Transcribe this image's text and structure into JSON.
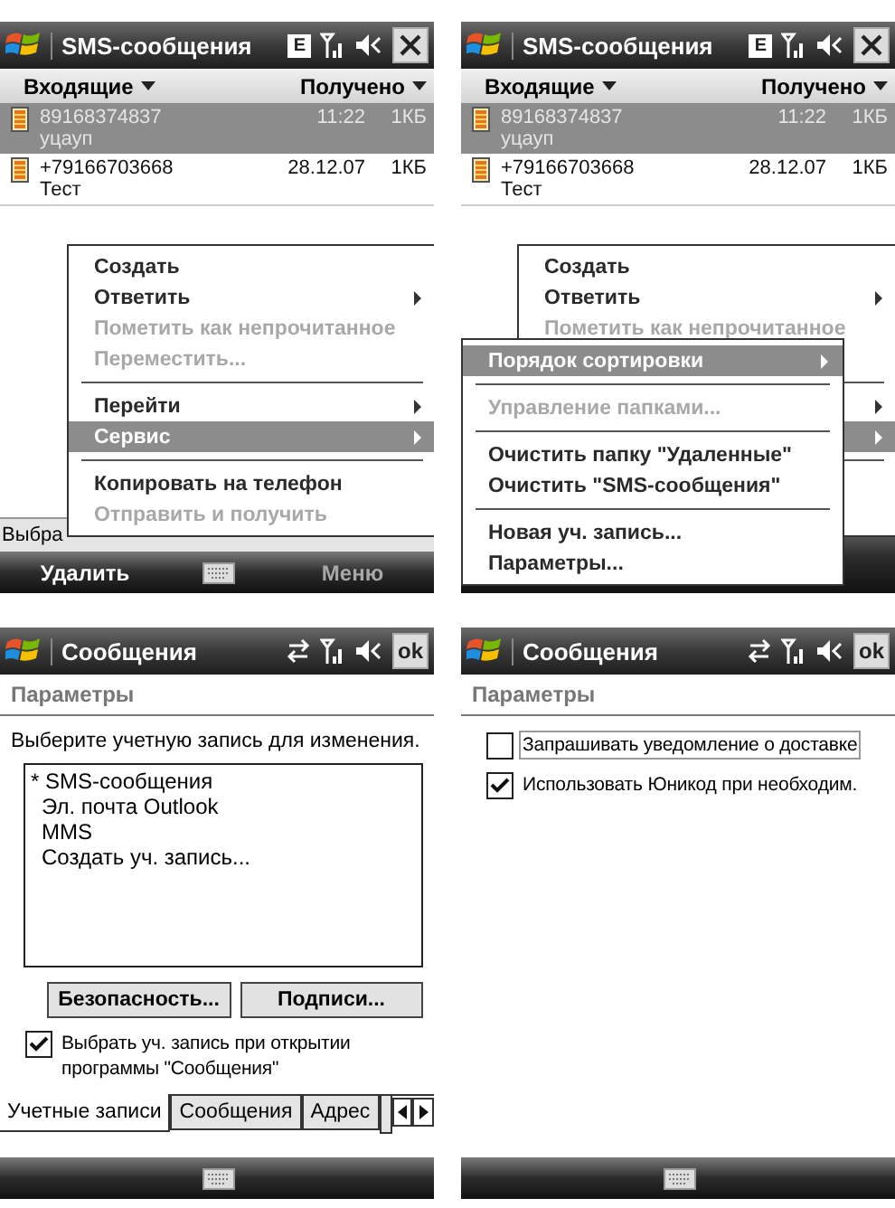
{
  "screens": [
    {
      "kind": "message_list",
      "title_bar": {
        "title": "SMS-сообщения",
        "indicators": [
          {
            "kind": "edge",
            "label": "E"
          },
          {
            "kind": "signal"
          },
          {
            "kind": "volume"
          }
        ],
        "action": {
          "kind": "close"
        }
      },
      "list_header": {
        "folder": "Входящие",
        "sort": "Получено"
      },
      "messages": [
        {
          "sender": "89168374837",
          "time": "11:22",
          "size": "1КБ",
          "preview": "уцауп",
          "selected": true
        },
        {
          "sender": "+79166703668",
          "time": "28.12.07",
          "size": "1КБ",
          "preview": "Тест",
          "selected": false
        }
      ],
      "status_text": "Выбра",
      "menu": {
        "items": [
          {
            "kind": "item",
            "label": "Создать",
            "disabled": false,
            "submenu": false,
            "selected": false
          },
          {
            "kind": "item",
            "label": "Ответить",
            "disabled": false,
            "submenu": true,
            "selected": false
          },
          {
            "kind": "item",
            "label": "Пометить как непрочитанное",
            "disabled": true,
            "submenu": false,
            "selected": false
          },
          {
            "kind": "item",
            "label": "Переместить...",
            "disabled": true,
            "submenu": false,
            "selected": false
          },
          {
            "kind": "separator"
          },
          {
            "kind": "item",
            "label": "Перейти",
            "disabled": false,
            "submenu": true,
            "selected": false
          },
          {
            "kind": "item",
            "label": "Сервис",
            "disabled": false,
            "submenu": true,
            "selected": true
          },
          {
            "kind": "separator"
          },
          {
            "kind": "item",
            "label": "Копировать на телефон",
            "disabled": false,
            "submenu": false,
            "selected": false
          },
          {
            "kind": "item",
            "label": "Отправить и получить",
            "disabled": true,
            "submenu": false,
            "selected": false
          }
        ]
      },
      "softkeys": [
        {
          "label": "Удалить",
          "dimmed": false
        },
        {
          "label": "Меню",
          "dimmed": true
        }
      ]
    },
    {
      "kind": "message_list",
      "title_bar": {
        "title": "SMS-сообщения",
        "indicators": [
          {
            "kind": "edge",
            "label": "E"
          },
          {
            "kind": "signal"
          },
          {
            "kind": "volume"
          }
        ],
        "action": {
          "kind": "close"
        }
      },
      "list_header": {
        "folder": "Входящие",
        "sort": "Получено"
      },
      "messages": [
        {
          "sender": "89168374837",
          "time": "11:22",
          "size": "1КБ",
          "preview": "уцауп",
          "selected": true
        },
        {
          "sender": "+79166703668",
          "time": "28.12.07",
          "size": "1КБ",
          "preview": "Тест",
          "selected": false
        }
      ],
      "menu": {
        "items": [
          {
            "kind": "item",
            "label": "Создать",
            "disabled": false,
            "submenu": false,
            "selected": false
          },
          {
            "kind": "item",
            "label": "Ответить",
            "disabled": false,
            "submenu": true,
            "selected": false
          },
          {
            "kind": "item",
            "label": "Пометить как непрочитанное",
            "disabled": true,
            "submenu": false,
            "selected": false
          },
          {
            "kind": "hidden"
          },
          {
            "kind": "separator"
          },
          {
            "kind": "arrow_only",
            "selected": false
          },
          {
            "kind": "arrow_only",
            "selected": true
          },
          {
            "kind": "separator"
          },
          {
            "kind": "hidden"
          },
          {
            "kind": "hidden"
          }
        ]
      },
      "submenu": {
        "items": [
          {
            "kind": "item",
            "label": "Порядок сортировки",
            "disabled": false,
            "submenu": true,
            "selected": true
          },
          {
            "kind": "separator"
          },
          {
            "kind": "item",
            "label": "Управление папками...",
            "disabled": true,
            "submenu": false,
            "selected": false
          },
          {
            "kind": "separator"
          },
          {
            "kind": "item",
            "label": "Очистить папку \"Удаленные\"",
            "disabled": false,
            "submenu": false,
            "selected": false
          },
          {
            "kind": "item",
            "label": "Очистить \"SMS-сообщения\"",
            "disabled": false,
            "submenu": false,
            "selected": false
          },
          {
            "kind": "separator"
          },
          {
            "kind": "item",
            "label": "Новая уч. запись...",
            "disabled": false,
            "submenu": false,
            "selected": false
          },
          {
            "kind": "item",
            "label": "Параметры...",
            "disabled": false,
            "submenu": false,
            "selected": false
          }
        ]
      }
    },
    {
      "kind": "settings",
      "title_bar": {
        "title": "Сообщения",
        "indicators": [
          {
            "kind": "sync"
          },
          {
            "kind": "signal"
          },
          {
            "kind": "volume"
          }
        ],
        "action": {
          "kind": "ok",
          "label": "ok"
        }
      },
      "header": "Параметры",
      "blocks": [
        {
          "kind": "prompt",
          "text": "Выберите учетную запись для изменения."
        },
        {
          "kind": "listbox",
          "items": [
            "* SMS-сообщения",
            "Эл. почта Outlook",
            "MMS",
            "Создать уч. запись..."
          ]
        },
        {
          "kind": "buttons",
          "buttons": [
            "Безопасность...",
            "Подписи..."
          ]
        },
        {
          "kind": "checkbox",
          "label": "Выбрать уч. запись при открытии программы \"Сообщения\"",
          "checked": true,
          "focused": false
        },
        {
          "kind": "tabs",
          "tabs": [
            {
              "label": "Учетные записи",
              "selected": true
            },
            {
              "label": "Сообщения",
              "selected": false
            },
            {
              "label": "Адрес",
              "selected": false
            }
          ]
        }
      ]
    },
    {
      "kind": "settings",
      "title_bar": {
        "title": "Сообщения",
        "indicators": [
          {
            "kind": "sync"
          },
          {
            "kind": "signal"
          },
          {
            "kind": "volume"
          }
        ],
        "action": {
          "kind": "ok",
          "label": "ok"
        }
      },
      "header": "Параметры",
      "blocks": [
        {
          "kind": "checkbox",
          "label": "Запрашивать уведомление о доставке",
          "checked": false,
          "focused": true
        },
        {
          "kind": "checkbox",
          "label": "Использовать Юникод при необходим.",
          "checked": true,
          "focused": false
        }
      ]
    }
  ]
}
